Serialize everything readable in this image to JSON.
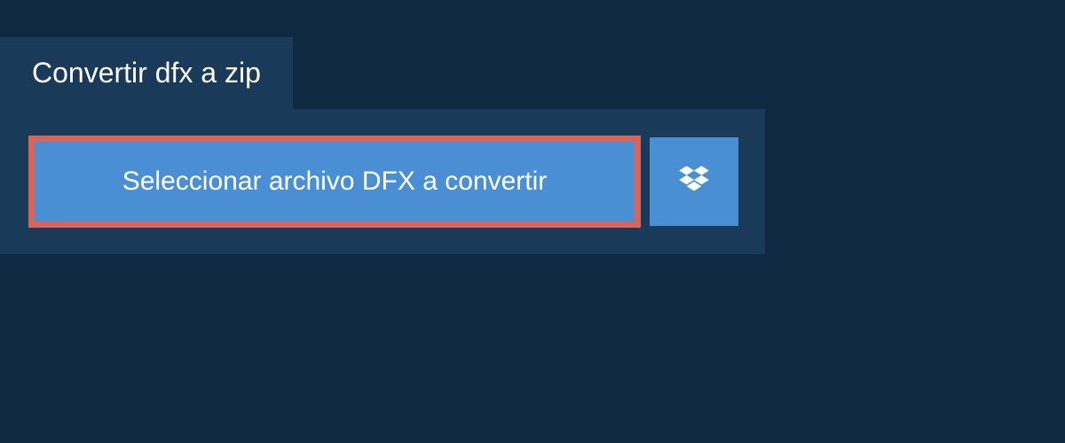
{
  "header": {
    "title": "Convertir dfx a zip"
  },
  "upload": {
    "select_label": "Seleccionar archivo DFX a convertir"
  }
}
